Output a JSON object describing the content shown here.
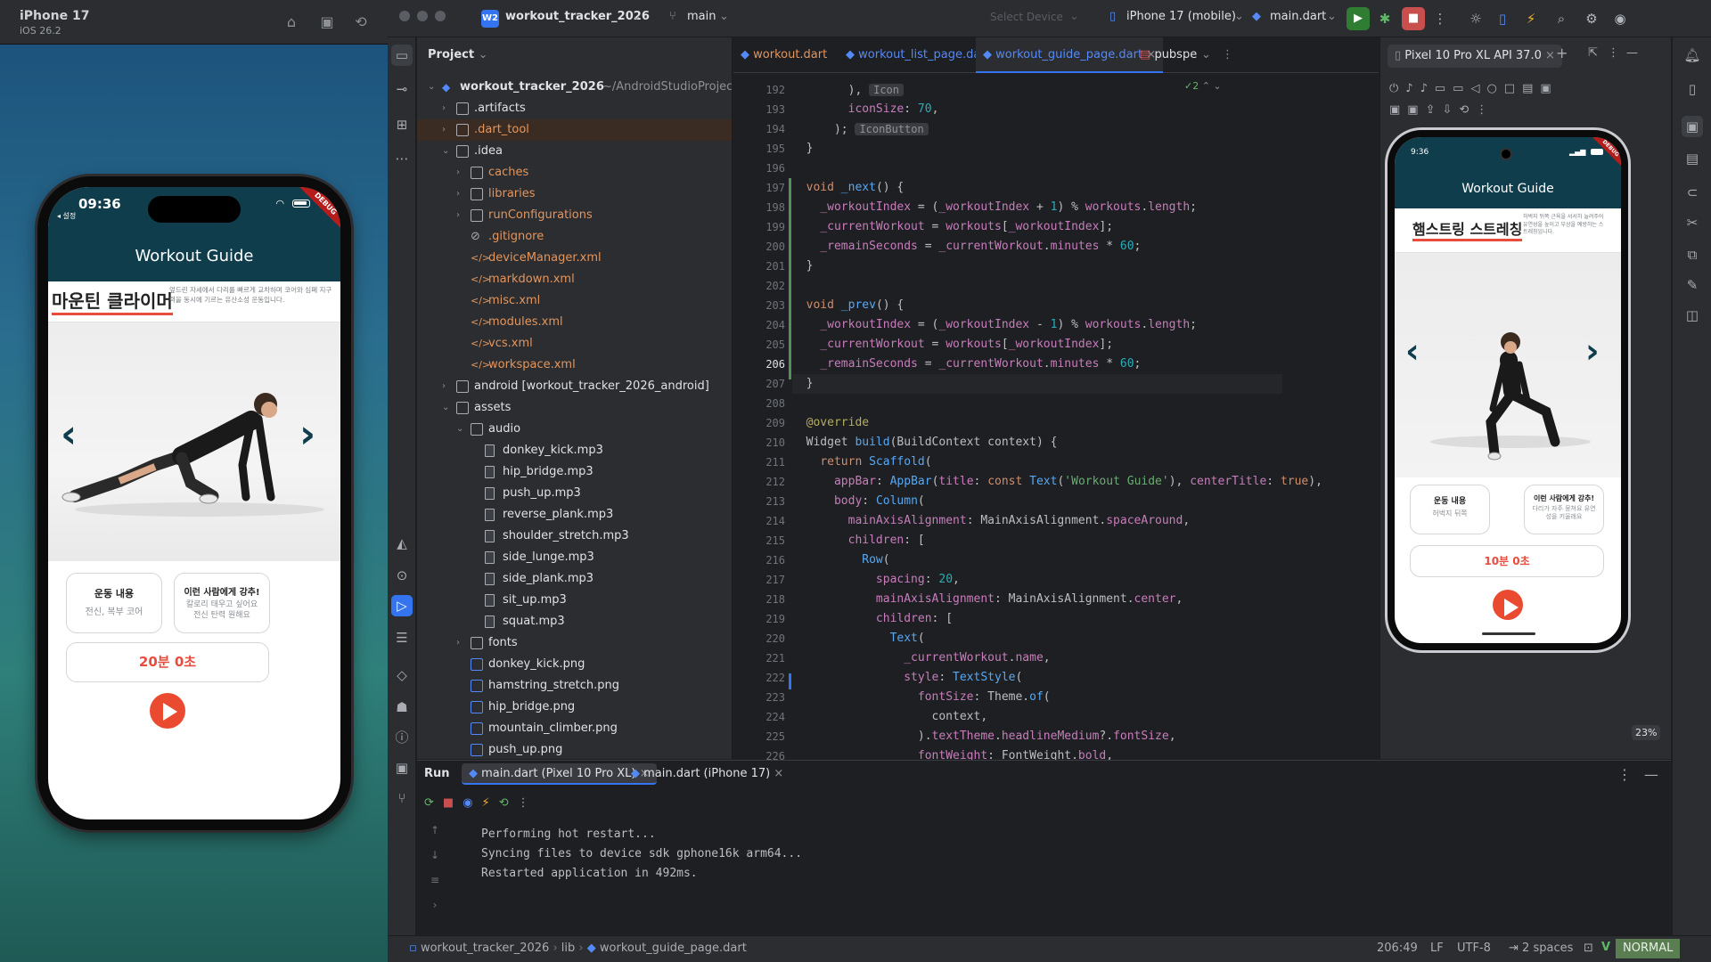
{
  "ios_sim": {
    "device": "iPhone 17",
    "os": "iOS 26.2",
    "status_time": "09:36",
    "back_label": "◂ 설정",
    "debug_label": "DEBUG",
    "app_title": "Workout Guide",
    "workout_name": "마운틴 클라이머",
    "workout_desc": "엎드린 자세에서 다리를 빠르게 교차하며 코어와 심폐 지구력을 동시에 기르는 유산소성 운동입니다.",
    "card1_title": "운동 내용",
    "card1_sub": "전신, 복부 코어",
    "card2_title": "이런 사람에게 강추!",
    "card2_sub": "칼로리 태우고 싶어요 전신 탄력 원해요",
    "timer": "20분 0초"
  },
  "ide": {
    "project_badge": "W2",
    "project_name": "workout_tracker_2026",
    "branch": "main",
    "select_device": "Select Device",
    "device": "iPhone 17 (mobile)",
    "run_config": "main.dart",
    "project_panel_title": "Project",
    "tree": [
      {
        "label": "workout_tracker_2026",
        "extra": "~/AndroidStudioProjects",
        "depth": 0,
        "type": "root",
        "open": true
      },
      {
        "label": ".artifacts",
        "depth": 1,
        "type": "folder",
        "open": false
      },
      {
        "label": ".dart_tool",
        "depth": 1,
        "type": "folder",
        "open": false,
        "color": "orange"
      },
      {
        "label": ".idea",
        "depth": 1,
        "type": "folder",
        "open": true
      },
      {
        "label": "caches",
        "depth": 2,
        "type": "folder",
        "open": false,
        "color": "orange"
      },
      {
        "label": "libraries",
        "depth": 2,
        "type": "folder",
        "open": false,
        "color": "orange"
      },
      {
        "label": "runConfigurations",
        "depth": 2,
        "type": "folder",
        "open": false,
        "color": "orange"
      },
      {
        "label": ".gitignore",
        "depth": 2,
        "type": "ignore",
        "color": "orange"
      },
      {
        "label": "deviceManager.xml",
        "depth": 2,
        "type": "xml",
        "color": "orange"
      },
      {
        "label": "markdown.xml",
        "depth": 2,
        "type": "xml",
        "color": "orange"
      },
      {
        "label": "misc.xml",
        "depth": 2,
        "type": "xml",
        "color": "orange"
      },
      {
        "label": "modules.xml",
        "depth": 2,
        "type": "xml",
        "color": "orange"
      },
      {
        "label": "vcs.xml",
        "depth": 2,
        "type": "xml",
        "color": "orange"
      },
      {
        "label": "workspace.xml",
        "depth": 2,
        "type": "xml",
        "color": "orange"
      },
      {
        "label": "android [workout_tracker_2026_android]",
        "depth": 1,
        "type": "folder",
        "open": false
      },
      {
        "label": "assets",
        "depth": 1,
        "type": "folder",
        "open": true
      },
      {
        "label": "audio",
        "depth": 2,
        "type": "folder",
        "open": true
      },
      {
        "label": "donkey_kick.mp3",
        "depth": 3,
        "type": "file"
      },
      {
        "label": "hip_bridge.mp3",
        "depth": 3,
        "type": "file"
      },
      {
        "label": "push_up.mp3",
        "depth": 3,
        "type": "file"
      },
      {
        "label": "reverse_plank.mp3",
        "depth": 3,
        "type": "file"
      },
      {
        "label": "shoulder_stretch.mp3",
        "depth": 3,
        "type": "file"
      },
      {
        "label": "side_lunge.mp3",
        "depth": 3,
        "type": "file"
      },
      {
        "label": "side_plank.mp3",
        "depth": 3,
        "type": "file"
      },
      {
        "label": "sit_up.mp3",
        "depth": 3,
        "type": "file"
      },
      {
        "label": "squat.mp3",
        "depth": 3,
        "type": "file"
      },
      {
        "label": "fonts",
        "depth": 2,
        "type": "folder",
        "open": false
      },
      {
        "label": "donkey_kick.png",
        "depth": 2,
        "type": "png"
      },
      {
        "label": "hamstring_stretch.png",
        "depth": 2,
        "type": "png"
      },
      {
        "label": "hip_bridge.png",
        "depth": 2,
        "type": "png"
      },
      {
        "label": "mountain_climber.png",
        "depth": 2,
        "type": "png"
      },
      {
        "label": "push_up.png",
        "depth": 2,
        "type": "png"
      }
    ],
    "editor_tabs": [
      "workout.dart",
      "workout_list_page.dart",
      "workout_guide_page.dart",
      "pubspe"
    ],
    "active_tab": "workout_guide_page.dart",
    "inspection_count": "2",
    "code": [
      {
        "n": "192",
        "html": "        ), <span class=\"hint\">Icon</span>"
      },
      {
        "n": "193",
        "html": "        <span class=\"prop\">iconSize</span>: <span class=\"num\">70</span>,"
      },
      {
        "n": "194",
        "html": "      ); <span class=\"hint\">IconButton</span>"
      },
      {
        "n": "195",
        "html": "  }"
      },
      {
        "n": "196",
        "html": ""
      },
      {
        "n": "197",
        "html": "  <span class=\"kw\">void</span> <span class=\"fn\">_next</span>() {"
      },
      {
        "n": "198",
        "html": "    <span class=\"prop\">_workoutIndex</span> = (<span class=\"prop\">_workoutIndex</span> + <span class=\"num\">1</span>) % <span class=\"prop\">workouts</span>.<span class=\"prop\">length</span>;"
      },
      {
        "n": "199",
        "html": "    <span class=\"prop\">_currentWorkout</span> = <span class=\"prop\">workouts</span>[<span class=\"prop\">_workoutIndex</span>];"
      },
      {
        "n": "200",
        "html": "    <span class=\"prop\">_remainSeconds</span> = <span class=\"prop\">_currentWorkout</span>.<span class=\"prop\">minutes</span> * <span class=\"num\">60</span>;"
      },
      {
        "n": "201",
        "html": "  }"
      },
      {
        "n": "202",
        "html": ""
      },
      {
        "n": "203",
        "html": "  <span class=\"kw\">void</span> <span class=\"fn\">_prev</span>() {"
      },
      {
        "n": "204",
        "html": "    <span class=\"prop\">_workoutIndex</span> = (<span class=\"prop\">_workoutIndex</span> - <span class=\"num\">1</span>) % <span class=\"prop\">workouts</span>.<span class=\"prop\">length</span>;"
      },
      {
        "n": "205",
        "html": "    <span class=\"prop\">_currentWorkout</span> = <span class=\"prop\">workouts</span>[<span class=\"prop\">_workoutIndex</span>];"
      },
      {
        "n": "206",
        "html": "    <span class=\"prop\">_remainSeconds</span> = <span class=\"prop\">_currentWorkout</span>.<span class=\"prop\">minutes</span> * <span class=\"num\">60</span>;"
      },
      {
        "n": "207",
        "html": "  }"
      },
      {
        "n": "208",
        "html": ""
      },
      {
        "n": "209",
        "html": "  <span class=\"ann\">@override</span>"
      },
      {
        "n": "210",
        "html": "  Widget <span class=\"fn\">build</span>(BuildContext context) {"
      },
      {
        "n": "211",
        "html": "    <span class=\"kw\">return</span> <span class=\"ty\">Scaffold</span>("
      },
      {
        "n": "212",
        "html": "      <span class=\"prop\">appBar</span>: <span class=\"ty\">AppBar</span>(<span class=\"prop\">title</span>: <span class=\"kw\">const</span> <span class=\"ty\">Text</span>(<span class=\"str\">'Workout Guide'</span>), <span class=\"prop\">centerTitle</span>: <span class=\"kw\">true</span>),"
      },
      {
        "n": "213",
        "html": "      <span class=\"prop\">body</span>: <span class=\"ty\">Column</span>("
      },
      {
        "n": "214",
        "html": "        <span class=\"prop\">mainAxisAlignment</span>: MainAxisAlignment.<span class=\"prop\">spaceAround</span>,"
      },
      {
        "n": "215",
        "html": "        <span class=\"prop\">children</span>: ["
      },
      {
        "n": "216",
        "html": "          <span class=\"ty\">Row</span>("
      },
      {
        "n": "217",
        "html": "            <span class=\"prop\">spacing</span>: <span class=\"num\">20</span>,"
      },
      {
        "n": "218",
        "html": "            <span class=\"prop\">mainAxisAlignment</span>: MainAxisAlignment.<span class=\"prop\">center</span>,"
      },
      {
        "n": "219",
        "html": "            <span class=\"prop\">children</span>: ["
      },
      {
        "n": "220",
        "html": "              <span class=\"ty\">Text</span>("
      },
      {
        "n": "221",
        "html": "                <span class=\"prop\">_currentWorkout</span>.<span class=\"prop\">name</span>,"
      },
      {
        "n": "222",
        "html": "                <span class=\"prop\">style</span>: <span class=\"ty\">TextStyle</span>("
      },
      {
        "n": "223",
        "html": "                  <span class=\"prop\">fontSize</span>: Theme.<span class=\"fn\">of</span>("
      },
      {
        "n": "224",
        "html": "                    context,"
      },
      {
        "n": "225",
        "html": "                  ).<span class=\"prop\">textTheme</span>.<span class=\"prop\">headlineMedium</span>?.<span class=\"prop\">fontSize</span>,"
      },
      {
        "n": "226",
        "html": "                  <span class=\"prop\">fontWeight</span>: FontWeight.<span class=\"prop\">bold</span>,"
      }
    ],
    "emulator_tab": "Pixel 10 Pro XL API 37.0",
    "run": {
      "title": "Run",
      "tab1": "main.dart (Pixel 10 Pro XL)",
      "tab2": "main.dart (iPhone 17)",
      "lines": [
        "Performing hot restart...",
        "Syncing files to device sdk gphone16k arm64...",
        "Restarted application in 492ms."
      ]
    },
    "status": {
      "crumb1": "workout_tracker_2026",
      "crumb2": "lib",
      "crumb3": "workout_guide_page.dart",
      "position": "206:49",
      "line_sep": "LF",
      "encoding": "UTF-8",
      "indent": "2 spaces",
      "mode": "NORMAL"
    }
  },
  "android": {
    "status_time": "9:36",
    "debug_label": "DEBUG",
    "app_title": "Workout Guide",
    "workout_name": "햄스트링 스트레칭",
    "workout_desc": "허벅지 뒤쪽 근육을 서서히 늘려주어 유연성을 높이고 부상을 예방하는 스트레칭입니다.",
    "card1_title": "운동 내용",
    "card1_sub": "허벅지 뒤쪽",
    "card2_title": "이런 사람에게 강추!",
    "card2_sub": "다리가 자주 뭉쳐요 유연성을 키울래요",
    "timer": "10분 0초",
    "zoom": "23%"
  }
}
